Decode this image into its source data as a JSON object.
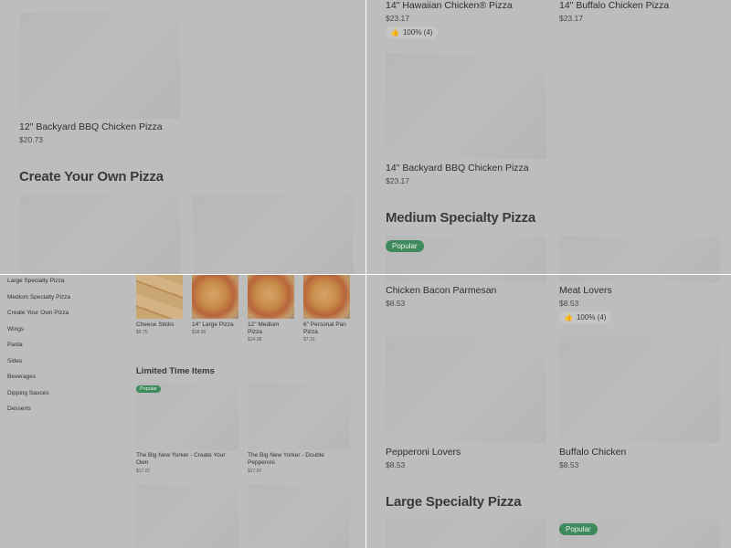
{
  "tl": {
    "item": {
      "title": "12\" Backyard BBQ Chicken Pizza",
      "price": "$20.73"
    },
    "section_heading": "Create Your Own Pizza"
  },
  "tr": {
    "items": [
      {
        "title": "14\" Hawaiian Chicken® Pizza",
        "price": "$23.17",
        "rating": "100% (4)"
      },
      {
        "title": "14\" Buffalo Chicken Pizza",
        "price": "$23.17"
      },
      {
        "title": "14\" Backyard BBQ Chicken Pizza",
        "price": "$23.17"
      }
    ],
    "section_heading": "Medium Specialty Pizza",
    "popular_badge": "Popular"
  },
  "bl": {
    "sidebar": [
      "Large Specialty Pizza",
      "Medium Specialty Pizza",
      "Create Your Own Pizza",
      "Wings",
      "Pasta",
      "Sides",
      "Beverages",
      "Dipping Sauces",
      "Desserts"
    ],
    "top_items": [
      {
        "title": "Cheese Sticks",
        "price": "$9.75"
      },
      {
        "title": "14\" Large Pizza",
        "price": "$18.95"
      },
      {
        "title": "12\" Medium Pizza",
        "price": "$14.38"
      },
      {
        "title": "6\" Personal Pan Pizza",
        "price": "$7.19"
      }
    ],
    "section_heading": "Limited Time Items",
    "popular_badge": "Popular",
    "limited_items": [
      {
        "title": "The Big New Yorker - Create Your Own",
        "price": "$17.07"
      },
      {
        "title": "The Big New Yorker - Double Pepperoni",
        "price": "$17.07"
      }
    ]
  },
  "br": {
    "items": [
      {
        "title": "Chicken Bacon Parmesan",
        "price": "$8.53"
      },
      {
        "title": "Meat Lovers",
        "price": "$8.53",
        "rating": "100% (4)"
      },
      {
        "title": "Pepperoni Lovers",
        "price": "$8.53"
      },
      {
        "title": "Buffalo Chicken",
        "price": "$8.53"
      }
    ],
    "section_heading": "Large Specialty Pizza",
    "popular_badge": "Popular"
  }
}
